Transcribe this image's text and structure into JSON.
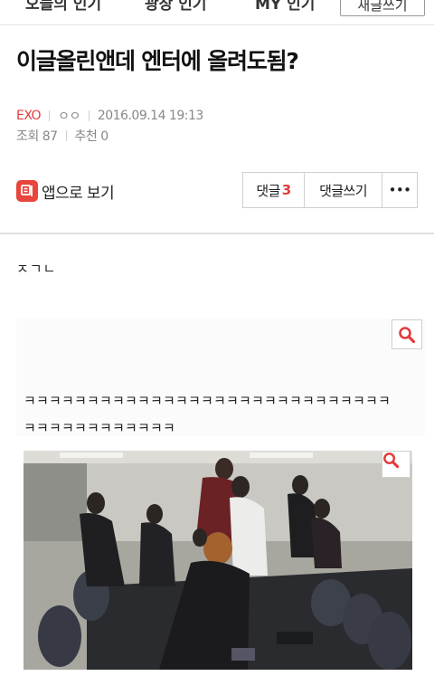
{
  "top_nav": {
    "items": [
      "오늘의 인기",
      "광장 인기",
      "MY 인기"
    ],
    "write_button": "새글쓰기"
  },
  "post": {
    "title": "이글올린앤데 엔터에 올려도됨?",
    "gallery": "EXO",
    "author": "ㅇㅇ",
    "datetime": "2016.09.14 19:13",
    "views": "조회 87",
    "recommend": "추천 0"
  },
  "actions": {
    "app_view": "앱으로 보기",
    "comments_label": "댓글",
    "comments_count": "3",
    "write_comment": "댓글쓰기",
    "more": "•••"
  },
  "content": {
    "intro": "ㅈㄱㄴ",
    "laugh_line1": "ㅋㅋㅋㅋㅋㅋㅋㅋㅋㅋㅋㅋㅋㅋㅋㅋㅋㅋㅋㅋㅋㅋㅋㅋㅋㅋㅋㅋㅋ",
    "laugh_line2": "ㅋㅋㅋㅋㅋㅋㅋㅋㅋㅋㅋㅋ"
  },
  "icons": {
    "zoom": "magnifier-icon",
    "app": "app-icon",
    "accent_color": "#e8453c"
  }
}
